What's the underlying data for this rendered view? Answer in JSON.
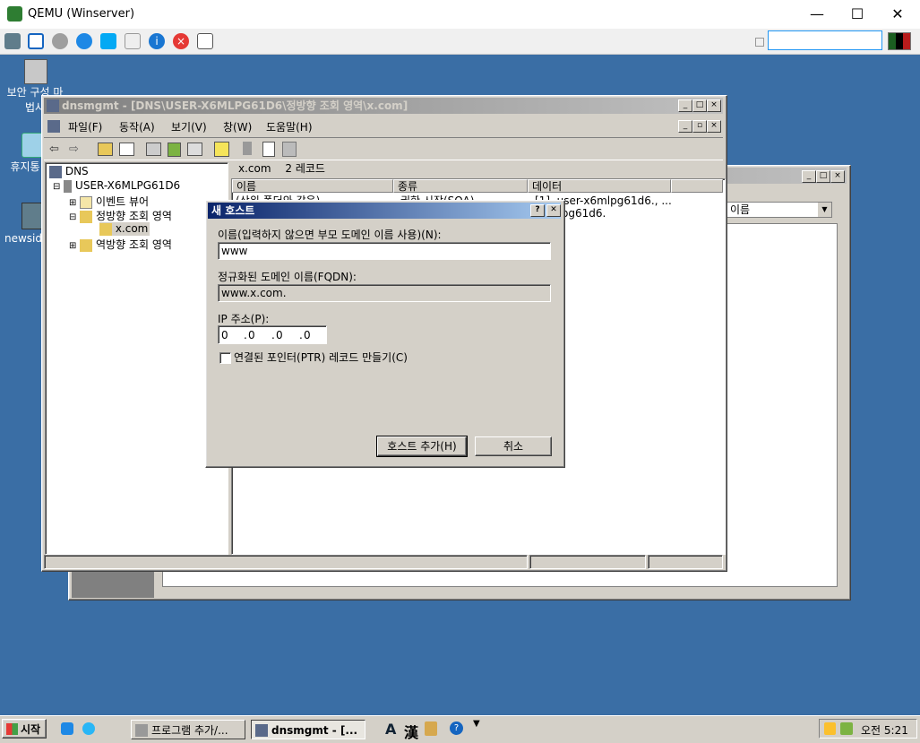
{
  "host": {
    "title": "QEMU (Winserver)",
    "minimize": "—",
    "maximize": "☐",
    "close": "✕"
  },
  "desktop": {
    "icons": [
      {
        "label": "보안 구성 마법사"
      },
      {
        "label": "휴지통"
      },
      {
        "label": "newsid"
      }
    ]
  },
  "mmc": {
    "title": "dnsmgmt - [DNS\\USER-X6MLPG61D6\\정방향 조회 영역\\x.com]",
    "menu": [
      "파일(F)",
      "동작(A)",
      "보기(V)",
      "창(W)",
      "도움말(H)"
    ],
    "tree": {
      "root": "DNS",
      "server": "USER-X6MLPG61D6",
      "event_viewer": "이벤트 뷰어",
      "forward": "정방향 조회 영역",
      "zone": "x.com",
      "reverse": "역방향 조회 영역"
    },
    "list_header": {
      "zone": "x.com",
      "count": "2 레코드"
    },
    "columns": [
      "이름",
      "종류",
      "데이터"
    ],
    "rows": [
      {
        "name": "(상위 폴더와 같음)",
        "type": "권한 시작(SOA)",
        "data": "[1], user-x6mlpg61d6., ..."
      },
      {
        "name": "",
        "type": "",
        "data": "x6mlpg61d6."
      }
    ]
  },
  "background_window": {
    "dropdown_value": "이름"
  },
  "dialog": {
    "title": "새 호스트",
    "help": "?",
    "close": "✕",
    "name_label": "이름(입력하지 않으면 부모 도메인 이름 사용)(N):",
    "name_value": "www",
    "fqdn_label": "정규화된 도메인 이름(FQDN):",
    "fqdn_value": "www.x.com.",
    "ip_label": "IP 주소(P):",
    "ip_octets": [
      "0",
      "0",
      "0",
      "0"
    ],
    "ptr_label": "연결된 포인터(PTR) 레코드 만들기(C)",
    "add_button": "호스트 추가(H)",
    "cancel_button": "취소"
  },
  "taskbar": {
    "start": "시작",
    "tasks": [
      "프로그램 추가/...",
      "dnsmgmt - [..."
    ],
    "ime_a": "A",
    "ime_han": "漢",
    "clock": "오전 5:21"
  }
}
